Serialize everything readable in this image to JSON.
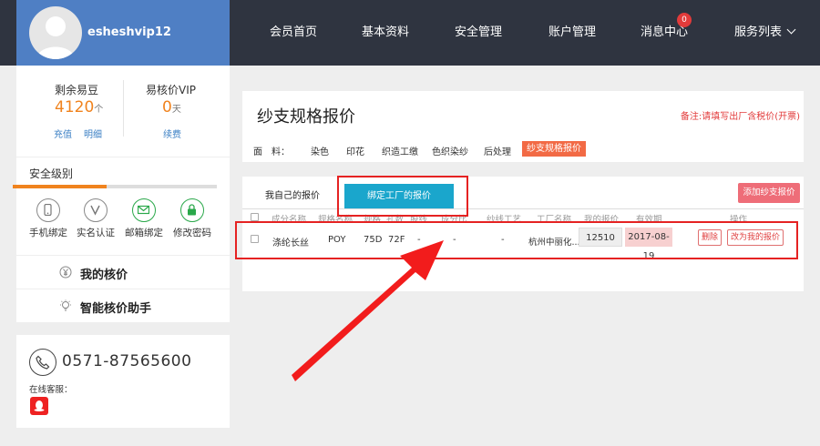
{
  "header": {
    "username": "esheshvip12",
    "nav": [
      {
        "label": "会员首页"
      },
      {
        "label": "基本资料"
      },
      {
        "label": "安全管理"
      },
      {
        "label": "账户管理"
      },
      {
        "label": "消息中心",
        "badge": "0"
      },
      {
        "label": "服务列表"
      }
    ]
  },
  "sidebar": {
    "beans": {
      "title": "剩余易豆",
      "value": "4120",
      "unit": "个",
      "links": [
        "充值",
        "明细"
      ]
    },
    "vip": {
      "title": "易核价VIP",
      "value": "0",
      "unit": "天",
      "link": "续费"
    },
    "security": {
      "title": "安全级别",
      "progress_percent": 46,
      "items": [
        {
          "label": "手机绑定",
          "icon": "phone-icon"
        },
        {
          "label": "实名认证",
          "icon": "verified-icon"
        },
        {
          "label": "邮箱绑定",
          "icon": "mail-icon"
        },
        {
          "label": "修改密码",
          "icon": "lock-icon"
        }
      ]
    },
    "menu": [
      {
        "label": "我的核价",
        "icon": "yuan-icon"
      },
      {
        "label": "智能核价助手",
        "icon": "bulb-icon"
      }
    ],
    "contact": {
      "phone": "0571-87565600",
      "service_label": "在线客服："
    }
  },
  "main": {
    "title": "纱支规格报价",
    "remark": "备注:请填写出厂含税价(开票)",
    "filter_label": "面　料：",
    "filters": [
      "染色",
      "印花",
      "织造工缴",
      "色织染纱",
      "后处理"
    ],
    "filter_active": "纱支规格报价",
    "tabs": [
      "我自己的报价",
      "绑定工厂的报价"
    ],
    "add_button": "添加纱支报价",
    "columns": [
      "成分名称",
      "规格名称",
      "规格",
      "孔数",
      "股线",
      "成分比",
      "纱线工艺",
      "工厂名称",
      "我的报价",
      "有效期",
      "操作"
    ],
    "row": {
      "component": "涤纶长丝",
      "spec_name": "POY",
      "spec": "75D",
      "holes": "72F",
      "ply": "-",
      "ratio": "-",
      "process": "-",
      "factory": "杭州中丽化...",
      "price": "12510",
      "valid_until": "2017-08-19",
      "delete": "删除",
      "change": "改为我的报价"
    }
  },
  "colors": {
    "accent_orange": "#f0831e",
    "tab_blue": "#1aa6cc",
    "annotation_red": "#e52222"
  }
}
